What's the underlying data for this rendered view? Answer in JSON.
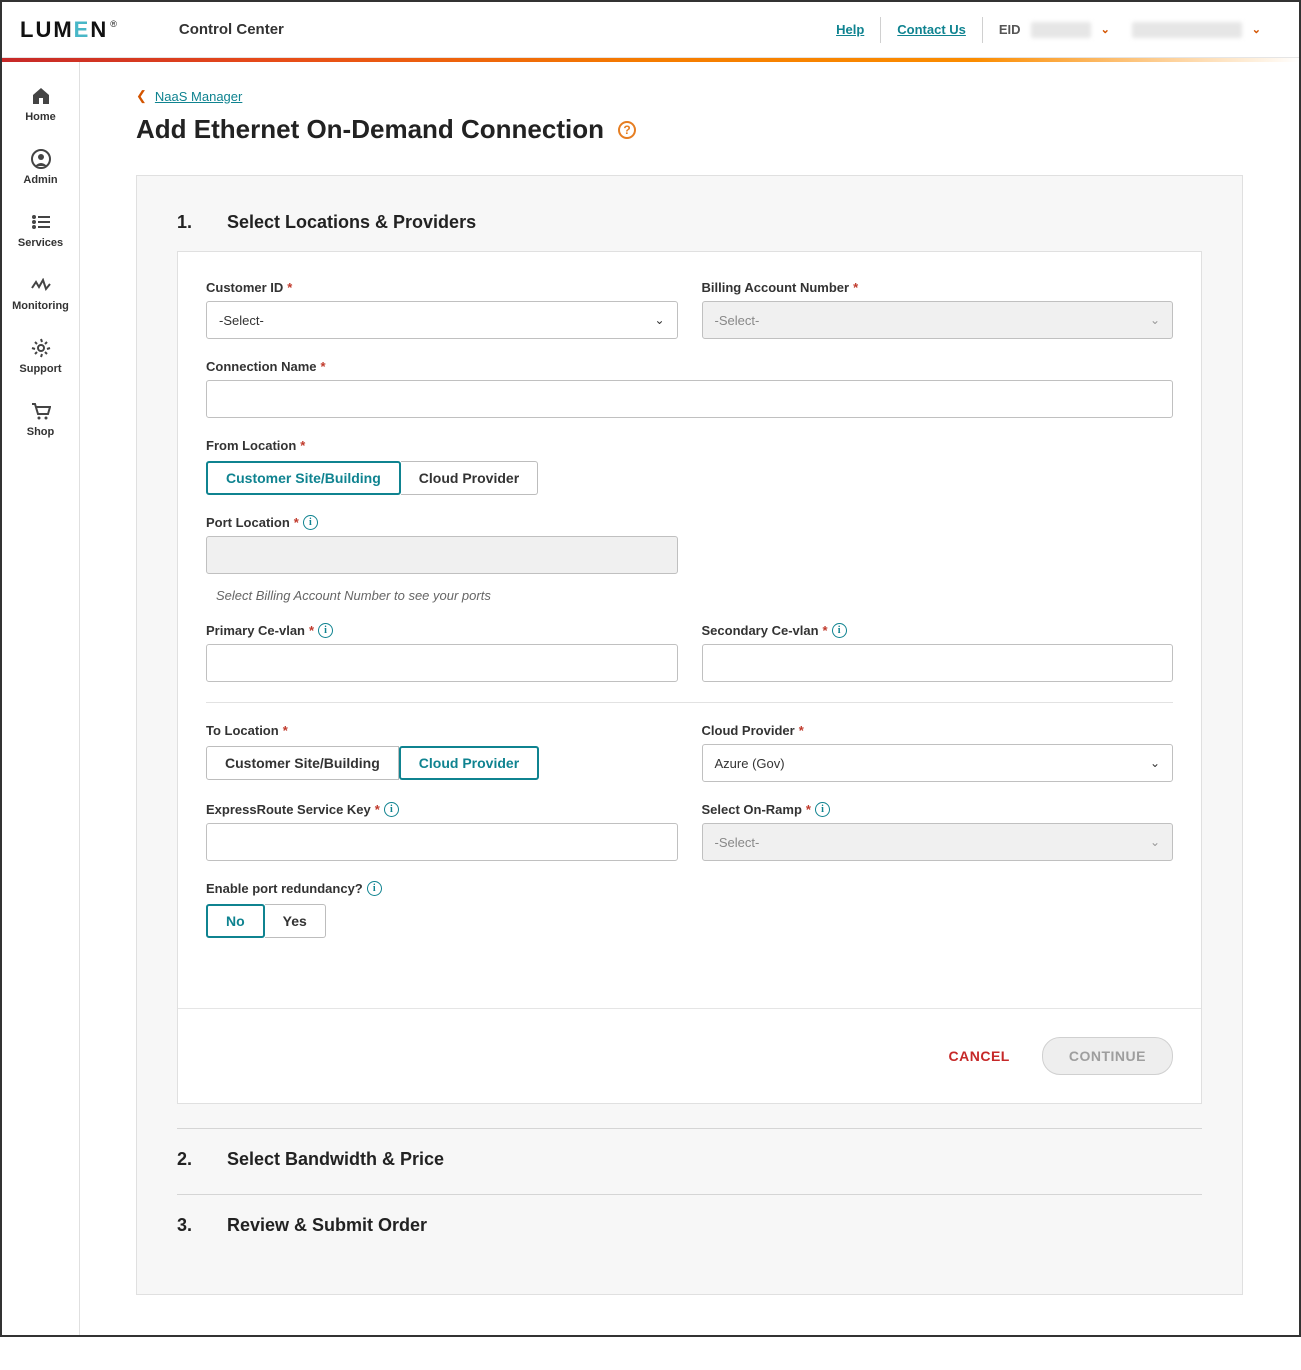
{
  "header": {
    "logo_text": "LUMEN",
    "app_title": "Control Center",
    "help_label": "Help",
    "contact_label": "Contact Us",
    "eid_label": "EID"
  },
  "sidebar": {
    "items": [
      {
        "key": "home",
        "label": "Home"
      },
      {
        "key": "admin",
        "label": "Admin"
      },
      {
        "key": "services",
        "label": "Services"
      },
      {
        "key": "monitoring",
        "label": "Monitoring"
      },
      {
        "key": "support",
        "label": "Support"
      },
      {
        "key": "shop",
        "label": "Shop"
      }
    ]
  },
  "breadcrumb": {
    "back_label": "NaaS Manager"
  },
  "page": {
    "title": "Add Ethernet On-Demand Connection"
  },
  "steps": {
    "s1": {
      "num": "1.",
      "title": "Select Locations & Providers"
    },
    "s2": {
      "num": "2.",
      "title": "Select Bandwidth & Price"
    },
    "s3": {
      "num": "3.",
      "title": "Review & Submit Order"
    }
  },
  "form": {
    "customer_id": {
      "label": "Customer ID",
      "placeholder": "-Select-",
      "value": "-Select-"
    },
    "billing_account": {
      "label": "Billing Account Number",
      "placeholder": "-Select-",
      "value": "-Select-"
    },
    "connection_name": {
      "label": "Connection Name",
      "value": ""
    },
    "from_location": {
      "label": "From Location",
      "options": [
        "Customer Site/Building",
        "Cloud Provider"
      ],
      "selected": "Customer Site/Building"
    },
    "port_location": {
      "label": "Port Location",
      "value": "",
      "hint": "Select Billing Account Number to see your ports"
    },
    "primary_cevlan": {
      "label": "Primary Ce-vlan",
      "value": ""
    },
    "secondary_cevlan": {
      "label": "Secondary Ce-vlan",
      "value": ""
    },
    "to_location": {
      "label": "To Location",
      "options": [
        "Customer Site/Building",
        "Cloud Provider"
      ],
      "selected": "Cloud Provider"
    },
    "cloud_provider": {
      "label": "Cloud Provider",
      "value": "Azure (Gov)"
    },
    "expressroute_key": {
      "label": "ExpressRoute Service Key",
      "value": ""
    },
    "select_onramp": {
      "label": "Select On-Ramp",
      "placeholder": "-Select-",
      "value": "-Select-"
    },
    "port_redundancy": {
      "label": "Enable port redundancy?",
      "options": [
        "No",
        "Yes"
      ],
      "selected": "No"
    }
  },
  "actions": {
    "cancel": "CANCEL",
    "continue": "CONTINUE"
  }
}
